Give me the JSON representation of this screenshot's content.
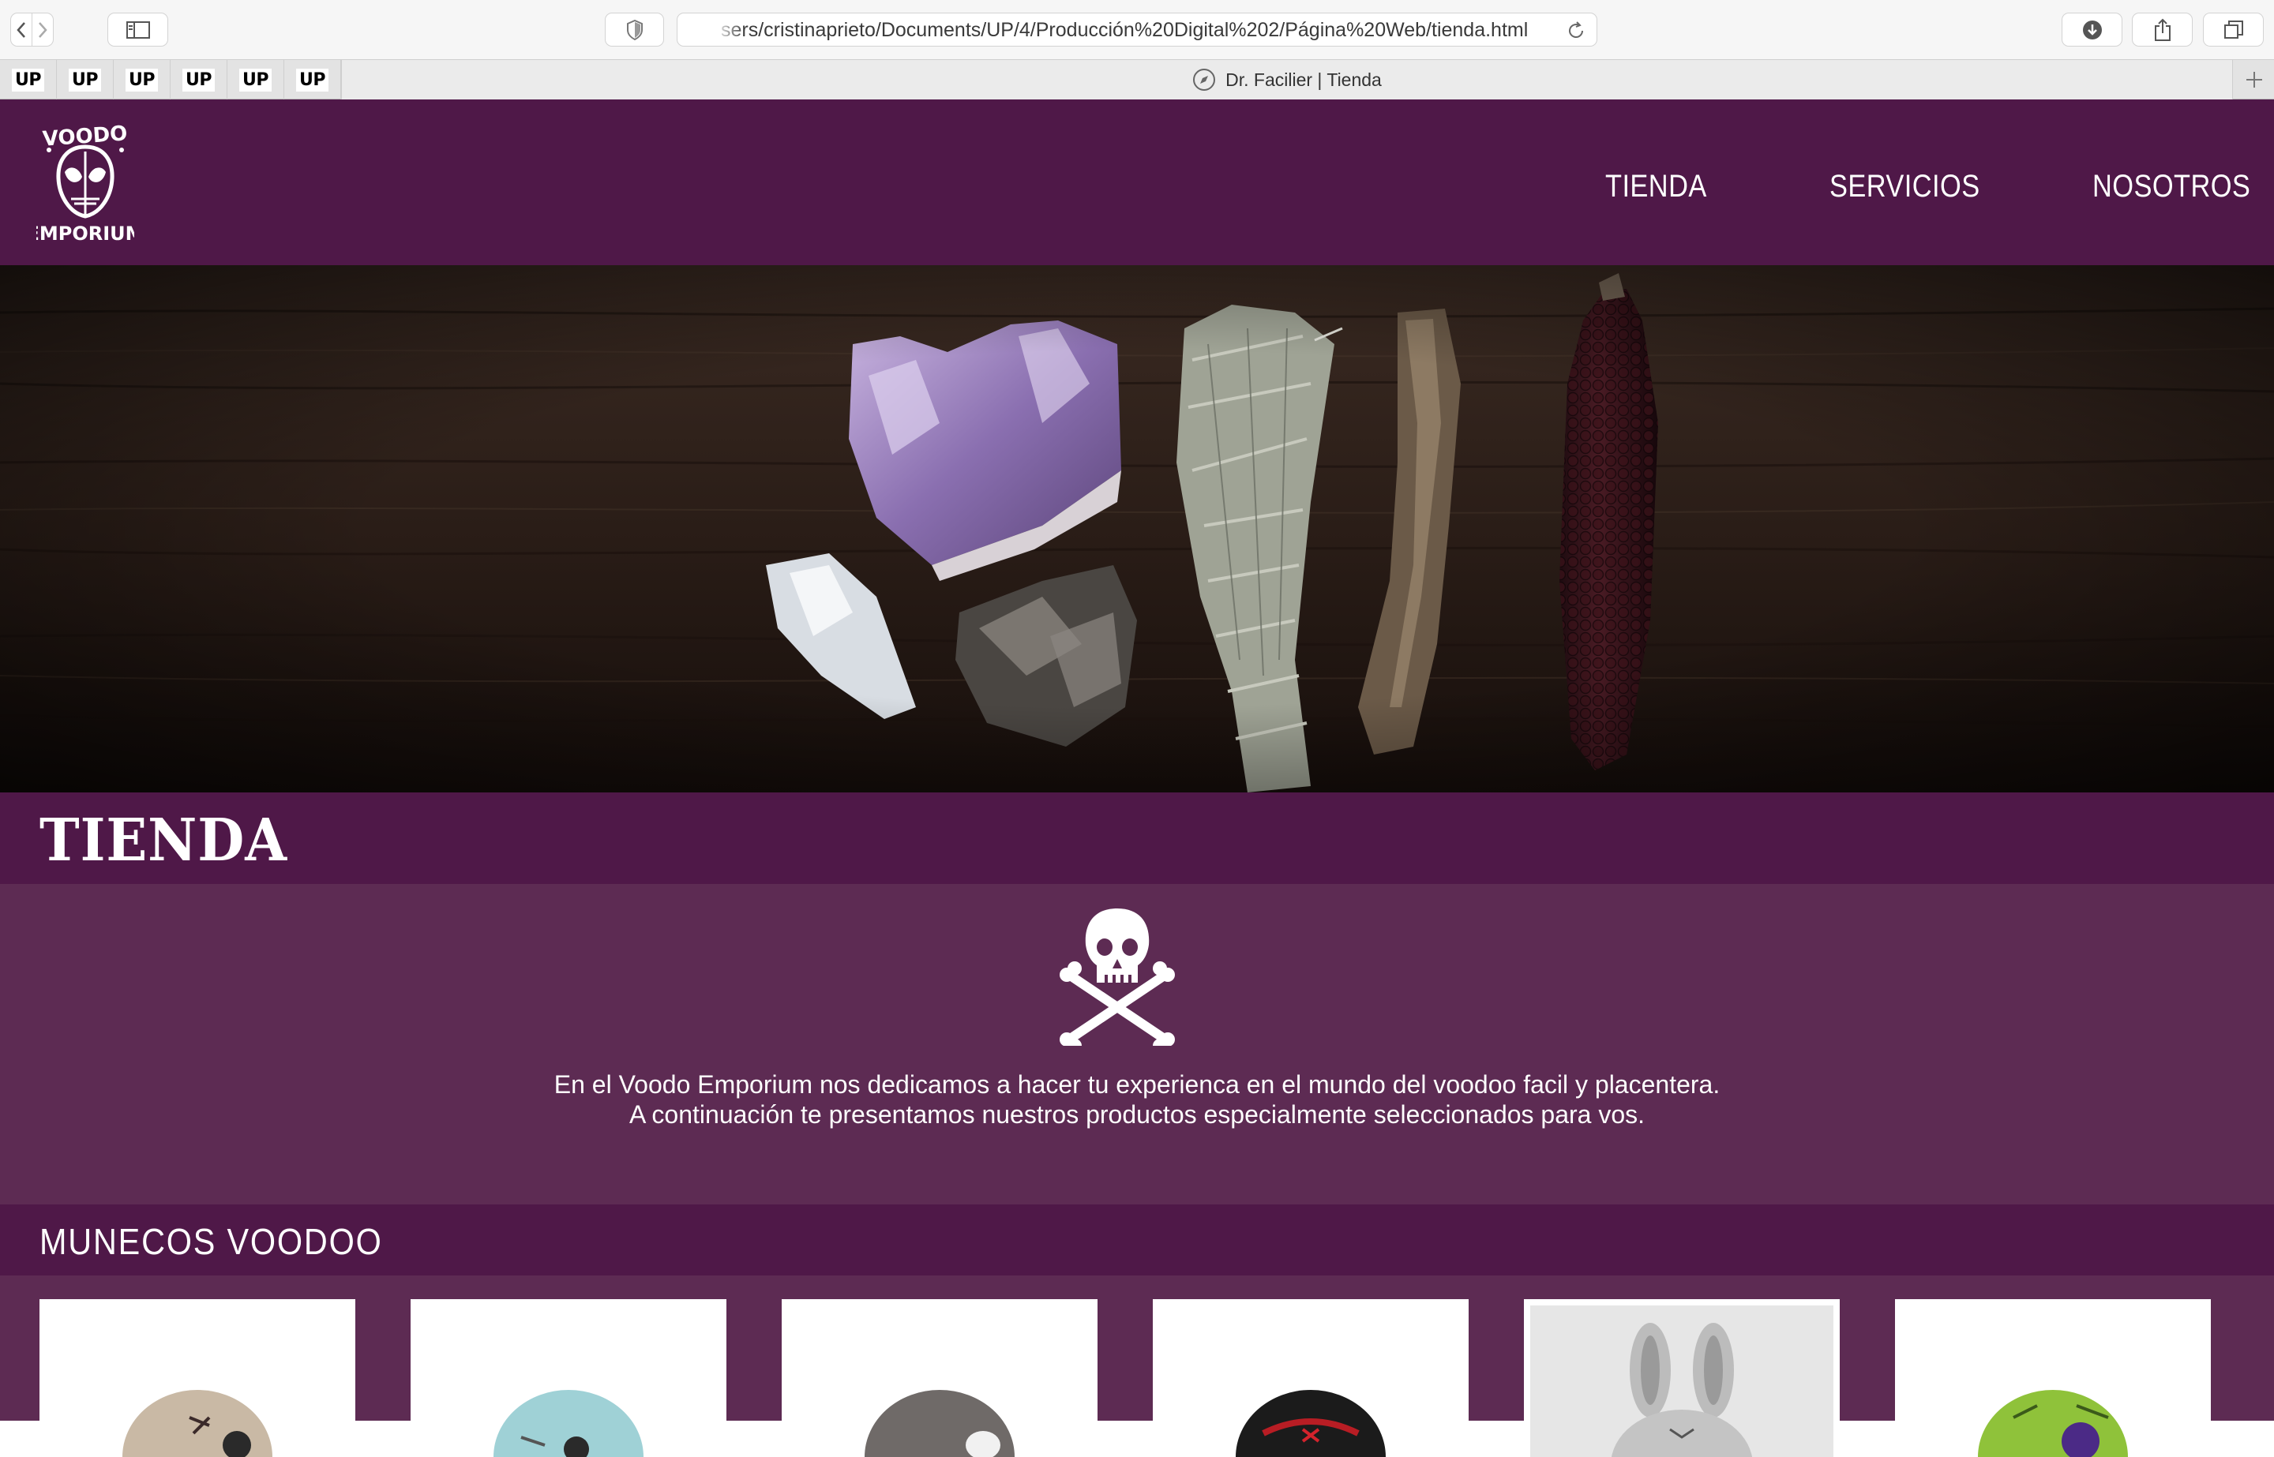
{
  "browser": {
    "url": "sers/cristinaprieto/Documents/UP/4/Producción%20Digital%202/Página%20Web/tienda.html",
    "tab_title": "Dr. Facilier | Tienda",
    "favorites": [
      "UP",
      "UP",
      "UP",
      "UP",
      "UP",
      "UP"
    ]
  },
  "header": {
    "logo_top": "VOODO",
    "logo_bottom": "EMPORIUM",
    "nav": [
      "TIENDA",
      "SERVICIOS",
      "NOSOTROS"
    ]
  },
  "page": {
    "title": "TIENDA",
    "intro_line1": "En el Voodo Emporium nos dedicamos a hacer tu experienca en el mundo del voodoo facil y placentera.",
    "intro_line2": "A continuación te presentamos nuestros productos especialmente seleccionados para vos.",
    "section_title": "MUNECOS VOODOO"
  },
  "colors": {
    "header_bg": "#4f1848",
    "intro_bg": "#5d2b53"
  },
  "icons": [
    "back-icon",
    "forward-icon",
    "sidebar-icon",
    "shield-icon",
    "reload-icon",
    "download-icon",
    "share-icon",
    "tabs-icon",
    "compass-icon",
    "plus-icon",
    "skull-crossbones-icon"
  ]
}
